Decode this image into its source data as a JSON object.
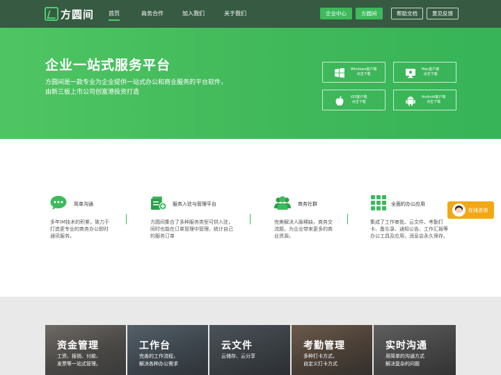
{
  "header": {
    "logo_text": "方圆间",
    "nav": [
      "首页",
      "商务合作",
      "加入我们",
      "关于我们"
    ],
    "buttons": [
      "企业中心",
      "方圆间",
      "帮助文档",
      "意见反馈"
    ]
  },
  "hero": {
    "title": "企业一站式服务平台",
    "desc_line1": "方圆间是一款专业为企业提供一站式办公和商业服务的平台软件，",
    "desc_line2": "由新三板上市公司创富港投资打造",
    "downloads": [
      {
        "line1": "Windows客户端",
        "line2": "点击下载",
        "icon": "windows-icon"
      },
      {
        "line1": "Mac客户端",
        "line2": "点击下载",
        "icon": "mac-icon"
      },
      {
        "line1": "iOS客户端",
        "line2": "点击下载",
        "icon": "apple-icon"
      },
      {
        "line1": "Android客户端",
        "line2": "点击下载",
        "icon": "android-icon"
      }
    ]
  },
  "features": [
    {
      "title": "简单沟通",
      "desc": "多年IM技术的积累，致力于打造更专业的商务办公即时通讯服务。",
      "icon": "chat-bubble-icon"
    },
    {
      "title": "服务入驻与管理平台",
      "desc": "方圆间集合了多种服务类型可供入驻，同时也能在订单管理中管理、统计自己的服务订单",
      "icon": "document-add-icon"
    },
    {
      "title": "商务社群",
      "desc": "完美解决人脉稀缺，商务交流题，为企业带来更多的商业资源。",
      "icon": "group-icon"
    },
    {
      "title": "全面的办公应用",
      "desc": "集成了工作审批、云文件、考勤打卡、备忘录、通知公告、工作汇报等办公工具及应用，消息会永久保存。",
      "icon": "grid-apps-icon"
    }
  ],
  "chat_widget": {
    "label": "在线咨询"
  },
  "cards": [
    {
      "title": "资金管理",
      "line1": "工资、报销、付款、",
      "line2": "发票等一站式管理。"
    },
    {
      "title": "工作台",
      "line1": "完善的工作流程，",
      "line2": "解决各种办公需求"
    },
    {
      "title": "云文件",
      "line1": "云储存、云分享",
      "line2": ""
    },
    {
      "title": "考勤管理",
      "line1": "多种打卡方式，",
      "line2": "自定义打卡方式"
    },
    {
      "title": "实时沟通",
      "line1": "用简单的沟通方式",
      "line2": "解决复杂的问题"
    }
  ],
  "colors": {
    "brand_green": "#3dba5c",
    "header_bg": "#365a42",
    "chat_orange": "#f2a815"
  }
}
